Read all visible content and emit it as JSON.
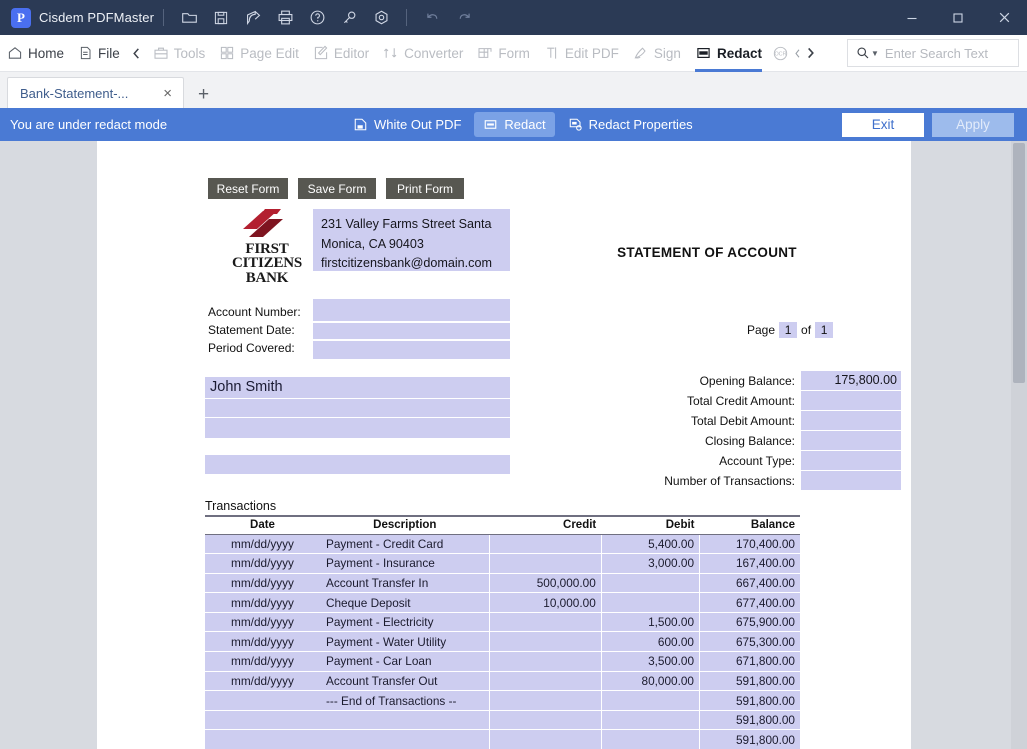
{
  "titlebar": {
    "app_name": "Cisdem PDFMaster",
    "logo_letter": "P",
    "icons": [
      "open-folder-icon",
      "save-icon",
      "share-icon",
      "print-icon",
      "help-icon",
      "key-icon",
      "target-icon",
      "undo-icon",
      "redo-icon"
    ],
    "window_controls": [
      "minimize",
      "maximize",
      "close"
    ]
  },
  "ribbon": {
    "items": [
      {
        "label": "Home",
        "icon": "home-icon",
        "state": "enabled"
      },
      {
        "label": "File",
        "icon": "file-icon",
        "state": "enabled"
      },
      {
        "label": "Tools",
        "icon": "toolbox-icon",
        "state": "disabled"
      },
      {
        "label": "Page Edit",
        "icon": "grid-icon",
        "state": "disabled"
      },
      {
        "label": "Editor",
        "icon": "pencil-square-icon",
        "state": "disabled"
      },
      {
        "label": "Converter",
        "icon": "convert-arrows-icon",
        "state": "disabled"
      },
      {
        "label": "Form",
        "icon": "form-icon",
        "state": "disabled"
      },
      {
        "label": "Edit PDF",
        "icon": "text-cursor-icon",
        "state": "disabled"
      },
      {
        "label": "Sign",
        "icon": "pen-icon",
        "state": "disabled"
      },
      {
        "label": "Redact",
        "icon": "redact-icon",
        "state": "active"
      },
      {
        "label": "OCR",
        "icon": "ocr-icon",
        "state": "disabled"
      }
    ],
    "scroll_left": "‹",
    "scroll_right": "›",
    "search_placeholder": "Enter Search Text",
    "search_value": ""
  },
  "tabstrip": {
    "tab_title": "Bank-Statement-...",
    "close_label": "×",
    "add_label": "+"
  },
  "redactbar": {
    "message": "You are under redact mode",
    "white_out_label": "White Out PDF",
    "redact_label": "Redact",
    "redact_properties_label": "Redact Properties",
    "exit_label": "Exit",
    "apply_label": "Apply",
    "accent_color": "#4a7ad4"
  },
  "document": {
    "form_buttons": {
      "reset": "Reset Form",
      "save": "Save Form",
      "print": "Print Form"
    },
    "logo": {
      "line1": "FIRST",
      "line2": "CITIZENS",
      "line3": "BANK",
      "color": "#b32030"
    },
    "address": "231 Valley Farms Street Santa Monica, CA 90403 firstcitizensbank@domain.com",
    "account_labels": {
      "account_number": "Account Number:",
      "statement_date": "Statement Date:",
      "period_covered": "Period Covered:"
    },
    "account_values": {
      "account_number": "",
      "statement_date": "",
      "period_covered": ""
    },
    "customer_name": "John Smith",
    "address_lines": [
      "",
      "",
      ""
    ],
    "statement_title": "STATEMENT OF ACCOUNT",
    "page_nav": {
      "page_label": "Page",
      "current": "1",
      "of_label": "of",
      "total": "1"
    },
    "summary": [
      {
        "label": "Opening Balance:",
        "value": "175,800.00"
      },
      {
        "label": "Total Credit Amount:",
        "value": ""
      },
      {
        "label": "Total Debit Amount:",
        "value": ""
      },
      {
        "label": "Closing Balance:",
        "value": ""
      },
      {
        "label": "Account Type:",
        "value": ""
      },
      {
        "label": "Number of Transactions:",
        "value": ""
      }
    ],
    "transactions_title": "Transactions",
    "table": {
      "headers": [
        "Date",
        "Description",
        "Credit",
        "Debit",
        "Balance"
      ],
      "rows": [
        {
          "date": "mm/dd/yyyy",
          "description": "Payment - Credit Card",
          "credit": "",
          "debit": "5,400.00",
          "balance": "170,400.00"
        },
        {
          "date": "mm/dd/yyyy",
          "description": "Payment - Insurance",
          "credit": "",
          "debit": "3,000.00",
          "balance": "167,400.00"
        },
        {
          "date": "mm/dd/yyyy",
          "description": "Account Transfer In",
          "credit": "500,000.00",
          "debit": "",
          "balance": "667,400.00"
        },
        {
          "date": "mm/dd/yyyy",
          "description": "Cheque Deposit",
          "credit": "10,000.00",
          "debit": "",
          "balance": "677,400.00"
        },
        {
          "date": "mm/dd/yyyy",
          "description": "Payment - Electricity",
          "credit": "",
          "debit": "1,500.00",
          "balance": "675,900.00"
        },
        {
          "date": "mm/dd/yyyy",
          "description": "Payment - Water Utility",
          "credit": "",
          "debit": "600.00",
          "balance": "675,300.00"
        },
        {
          "date": "mm/dd/yyyy",
          "description": "Payment - Car Loan",
          "credit": "",
          "debit": "3,500.00",
          "balance": "671,800.00"
        },
        {
          "date": "mm/dd/yyyy",
          "description": "Account Transfer Out",
          "credit": "",
          "debit": "80,000.00",
          "balance": "591,800.00"
        },
        {
          "date": "",
          "description": "--- End of Transactions --",
          "credit": "",
          "debit": "",
          "balance": "591,800.00"
        },
        {
          "date": "",
          "description": "",
          "credit": "",
          "debit": "",
          "balance": "591,800.00"
        },
        {
          "date": "",
          "description": "",
          "credit": "",
          "debit": "",
          "balance": "591,800.00"
        }
      ]
    }
  }
}
